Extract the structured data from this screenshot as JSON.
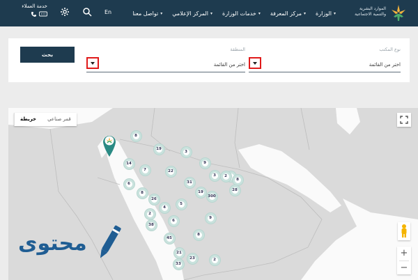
{
  "header": {
    "brand": {
      "line1": "الموارد البشرية",
      "line2": "والتنمية الاجتماعية"
    },
    "nav": [
      {
        "label": "الوزارة"
      },
      {
        "label": "مركز المعرفة"
      },
      {
        "label": "خدمات الوزارة"
      },
      {
        "label": "المركز الإعلامي"
      },
      {
        "label": "تواصل معنا"
      }
    ],
    "lang": "En",
    "customer_service": "خدمة العملاء"
  },
  "filter": {
    "office_type": {
      "label": "نوع المكتب",
      "value": "اختر من القائمة"
    },
    "region": {
      "label": "المنطقة",
      "value": "اختر من القائمة"
    },
    "search_label": "بحث"
  },
  "map": {
    "map_type": {
      "satellite": "قمر صناعي",
      "map": "خريطة"
    },
    "zoom": {
      "in": "+",
      "out": "−"
    },
    "clusters": [
      "8",
      "19",
      "3",
      "9",
      "14",
      "7",
      "22",
      "2",
      "6",
      "8",
      "31",
      "3",
      "2",
      "8",
      "26",
      "19",
      "300",
      "28",
      "2",
      "4",
      "5",
      "38",
      "6",
      "9",
      "45",
      "8",
      "21",
      "23",
      "2",
      "33"
    ]
  },
  "watermark": {
    "text": "محتوى"
  },
  "colors": {
    "header": "#1e3b4f",
    "accent": "#1e3b4f",
    "highlight": "#e01a1a",
    "cluster_ring": "#c9e2dd",
    "pin": "#2a8a84"
  }
}
